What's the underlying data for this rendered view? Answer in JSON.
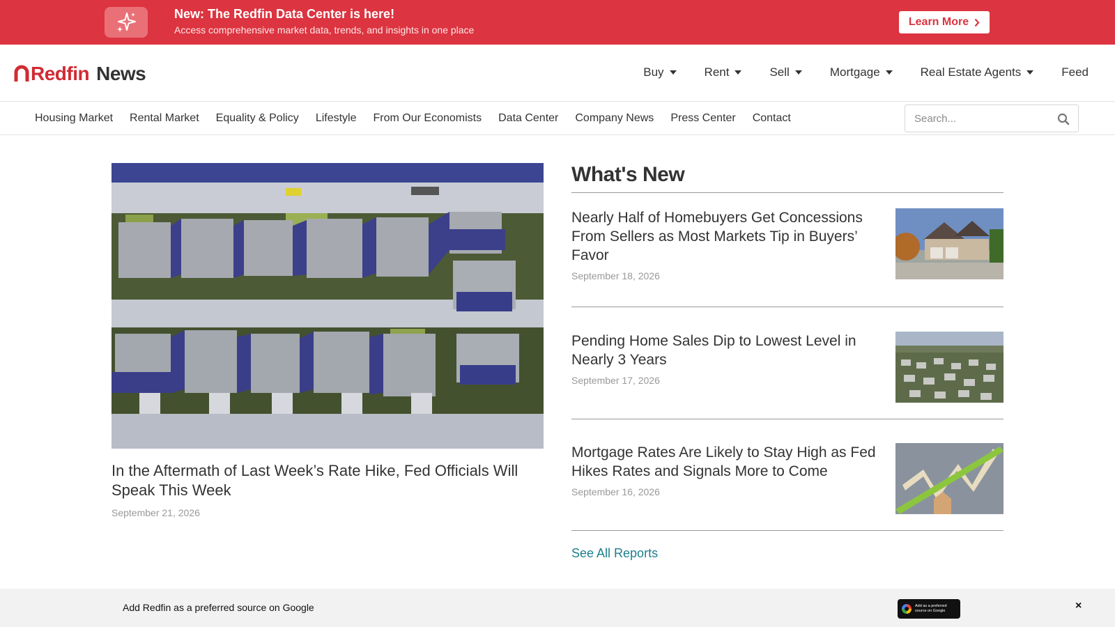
{
  "banner": {
    "title": "New: The Redfin Data Center is here!",
    "subtitle": "Access comprehensive market data, trends, and insights in one place",
    "button_label": "Learn More",
    "icon": "sparkles-icon",
    "color": "#dc3440"
  },
  "header": {
    "logo_brand": "Redfin",
    "logo_suffix": "News",
    "nav": [
      {
        "label": "Buy",
        "has_dropdown": true
      },
      {
        "label": "Rent",
        "has_dropdown": true
      },
      {
        "label": "Sell",
        "has_dropdown": true
      },
      {
        "label": "Mortgage",
        "has_dropdown": true
      },
      {
        "label": "Real Estate Agents",
        "has_dropdown": true
      },
      {
        "label": "Feed",
        "has_dropdown": false
      }
    ]
  },
  "subnav": {
    "items": [
      "Housing Market",
      "Rental Market",
      "Equality & Policy",
      "Lifestyle",
      "From Our Economists",
      "Data Center",
      "Company News",
      "Press Center",
      "Contact"
    ],
    "search_placeholder": "Search..."
  },
  "featured": {
    "title": "In the Aftermath of Last Week’s Rate Hike, Fed Officials Will Speak This Week",
    "date": "September 21, 2026"
  },
  "whats_new": {
    "heading": "What's New",
    "items": [
      {
        "title": "Nearly Half of Homebuyers Get Concessions From Sellers as Most Markets Tip in Buyers’ Favor",
        "date": "September 18, 2026"
      },
      {
        "title": "Pending Home Sales Dip to Lowest Level in Nearly 3 Years",
        "date": "September 17, 2026"
      },
      {
        "title": "Mortgage Rates Are Likely to Stay High as Fed Hikes Rates and Signals More to Come",
        "date": "September 16, 2026"
      }
    ],
    "see_all": "See All Reports",
    "link_color": "#1d7f8e"
  },
  "bottom_bar": {
    "text": "Add Redfin as a preferred source on Google",
    "badge_text": "Add as a preferred source on Google",
    "close": "×"
  }
}
